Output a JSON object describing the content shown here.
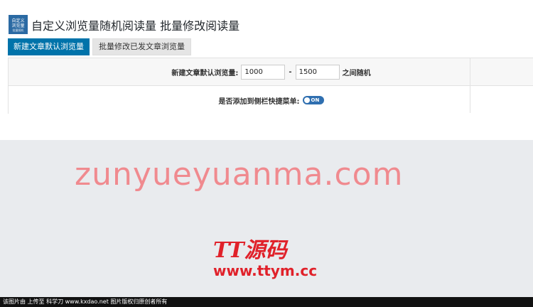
{
  "header": {
    "logo": {
      "line1": "自定义",
      "line2": "浏览量",
      "line3": "批量随机"
    },
    "title": "自定义浏览量随机阅读量 批量修改阅读量"
  },
  "tabs": [
    {
      "label": "新建文章默认浏览量",
      "active": true
    },
    {
      "label": "批量修改已发文章浏览量",
      "active": false
    }
  ],
  "form": {
    "default_views": {
      "label": "新建文章默认浏览量:",
      "min_value": "1000",
      "separator": "-",
      "max_value": "1500",
      "suffix": "之间随机"
    },
    "sidebar_menu": {
      "label": "是否添加到侧栏快捷菜单:",
      "toggle_text": "ON",
      "toggle_state": true
    }
  },
  "watermark": {
    "text": "zunyueyuanma.com",
    "logo": "TT源码",
    "url": "www.ttym.cc"
  },
  "footer": {
    "text": "该图片由  上传至 科学刀 www.kxdao.net 图片版权归原创者所有"
  },
  "colors": {
    "accent": "#0073aa",
    "toggle": "#2f6fb0",
    "watermark": "#f08a8f",
    "brand_red": "#e0212a"
  }
}
